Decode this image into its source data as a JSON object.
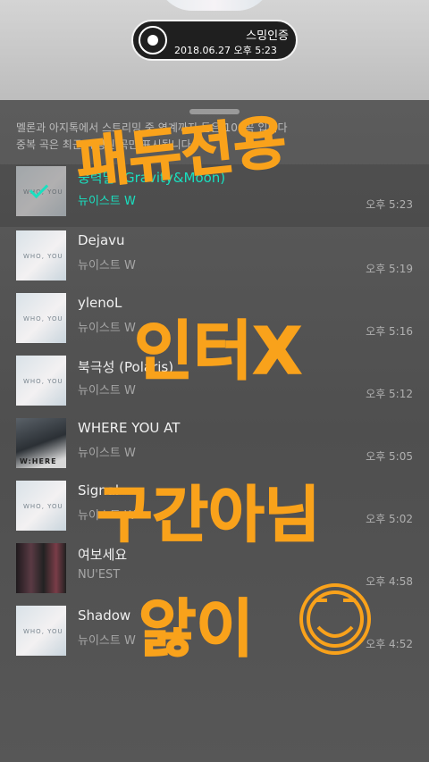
{
  "certification": {
    "title": "스밍인증",
    "timestamp": "2018.06.27 오후 5:23"
  },
  "notice": {
    "line1": "멜론과 아지톡에서 스트리밍 중 연계까지 들은 100곡 입니다",
    "line2": "중복 곡은 최근 재생된 곡만 표시됩니다."
  },
  "songs": [
    {
      "title": "중력달 (Gravity&Moon)",
      "artist": "뉴이스트 W",
      "time": "오후 5:23",
      "art": "WHO, YOU"
    },
    {
      "title": "Dejavu",
      "artist": "뉴이스트 W",
      "time": "오후 5:19",
      "art": "WHO, YOU"
    },
    {
      "title": "ylenoL",
      "artist": "뉴이스트 W",
      "time": "오후 5:16",
      "art": "WHO, YOU"
    },
    {
      "title": "북극성 (Polaris)",
      "artist": "뉴이스트 W",
      "time": "오후 5:12",
      "art": "WHO, YOU"
    },
    {
      "title": "WHERE YOU AT",
      "artist": "뉴이스트 W",
      "time": "오후 5:05",
      "art": "W:HERE"
    },
    {
      "title": "Signal",
      "artist": "뉴이스트 W",
      "time": "오후 5:02",
      "art": "WHO, YOU"
    },
    {
      "title": "여보세요",
      "artist": "NU'EST",
      "time": "오후 4:58",
      "art": ""
    },
    {
      "title": "Shadow",
      "artist": "뉴이스트 W",
      "time": "오후 4:52",
      "art": "WHO, YOU"
    }
  ],
  "handwriting": {
    "line1": "패듀전용",
    "line2": "인터X",
    "line3": "구간아님",
    "line4": "앓이"
  },
  "colors": {
    "accent": "#19e0c0",
    "doodle": "#f9a21b"
  }
}
